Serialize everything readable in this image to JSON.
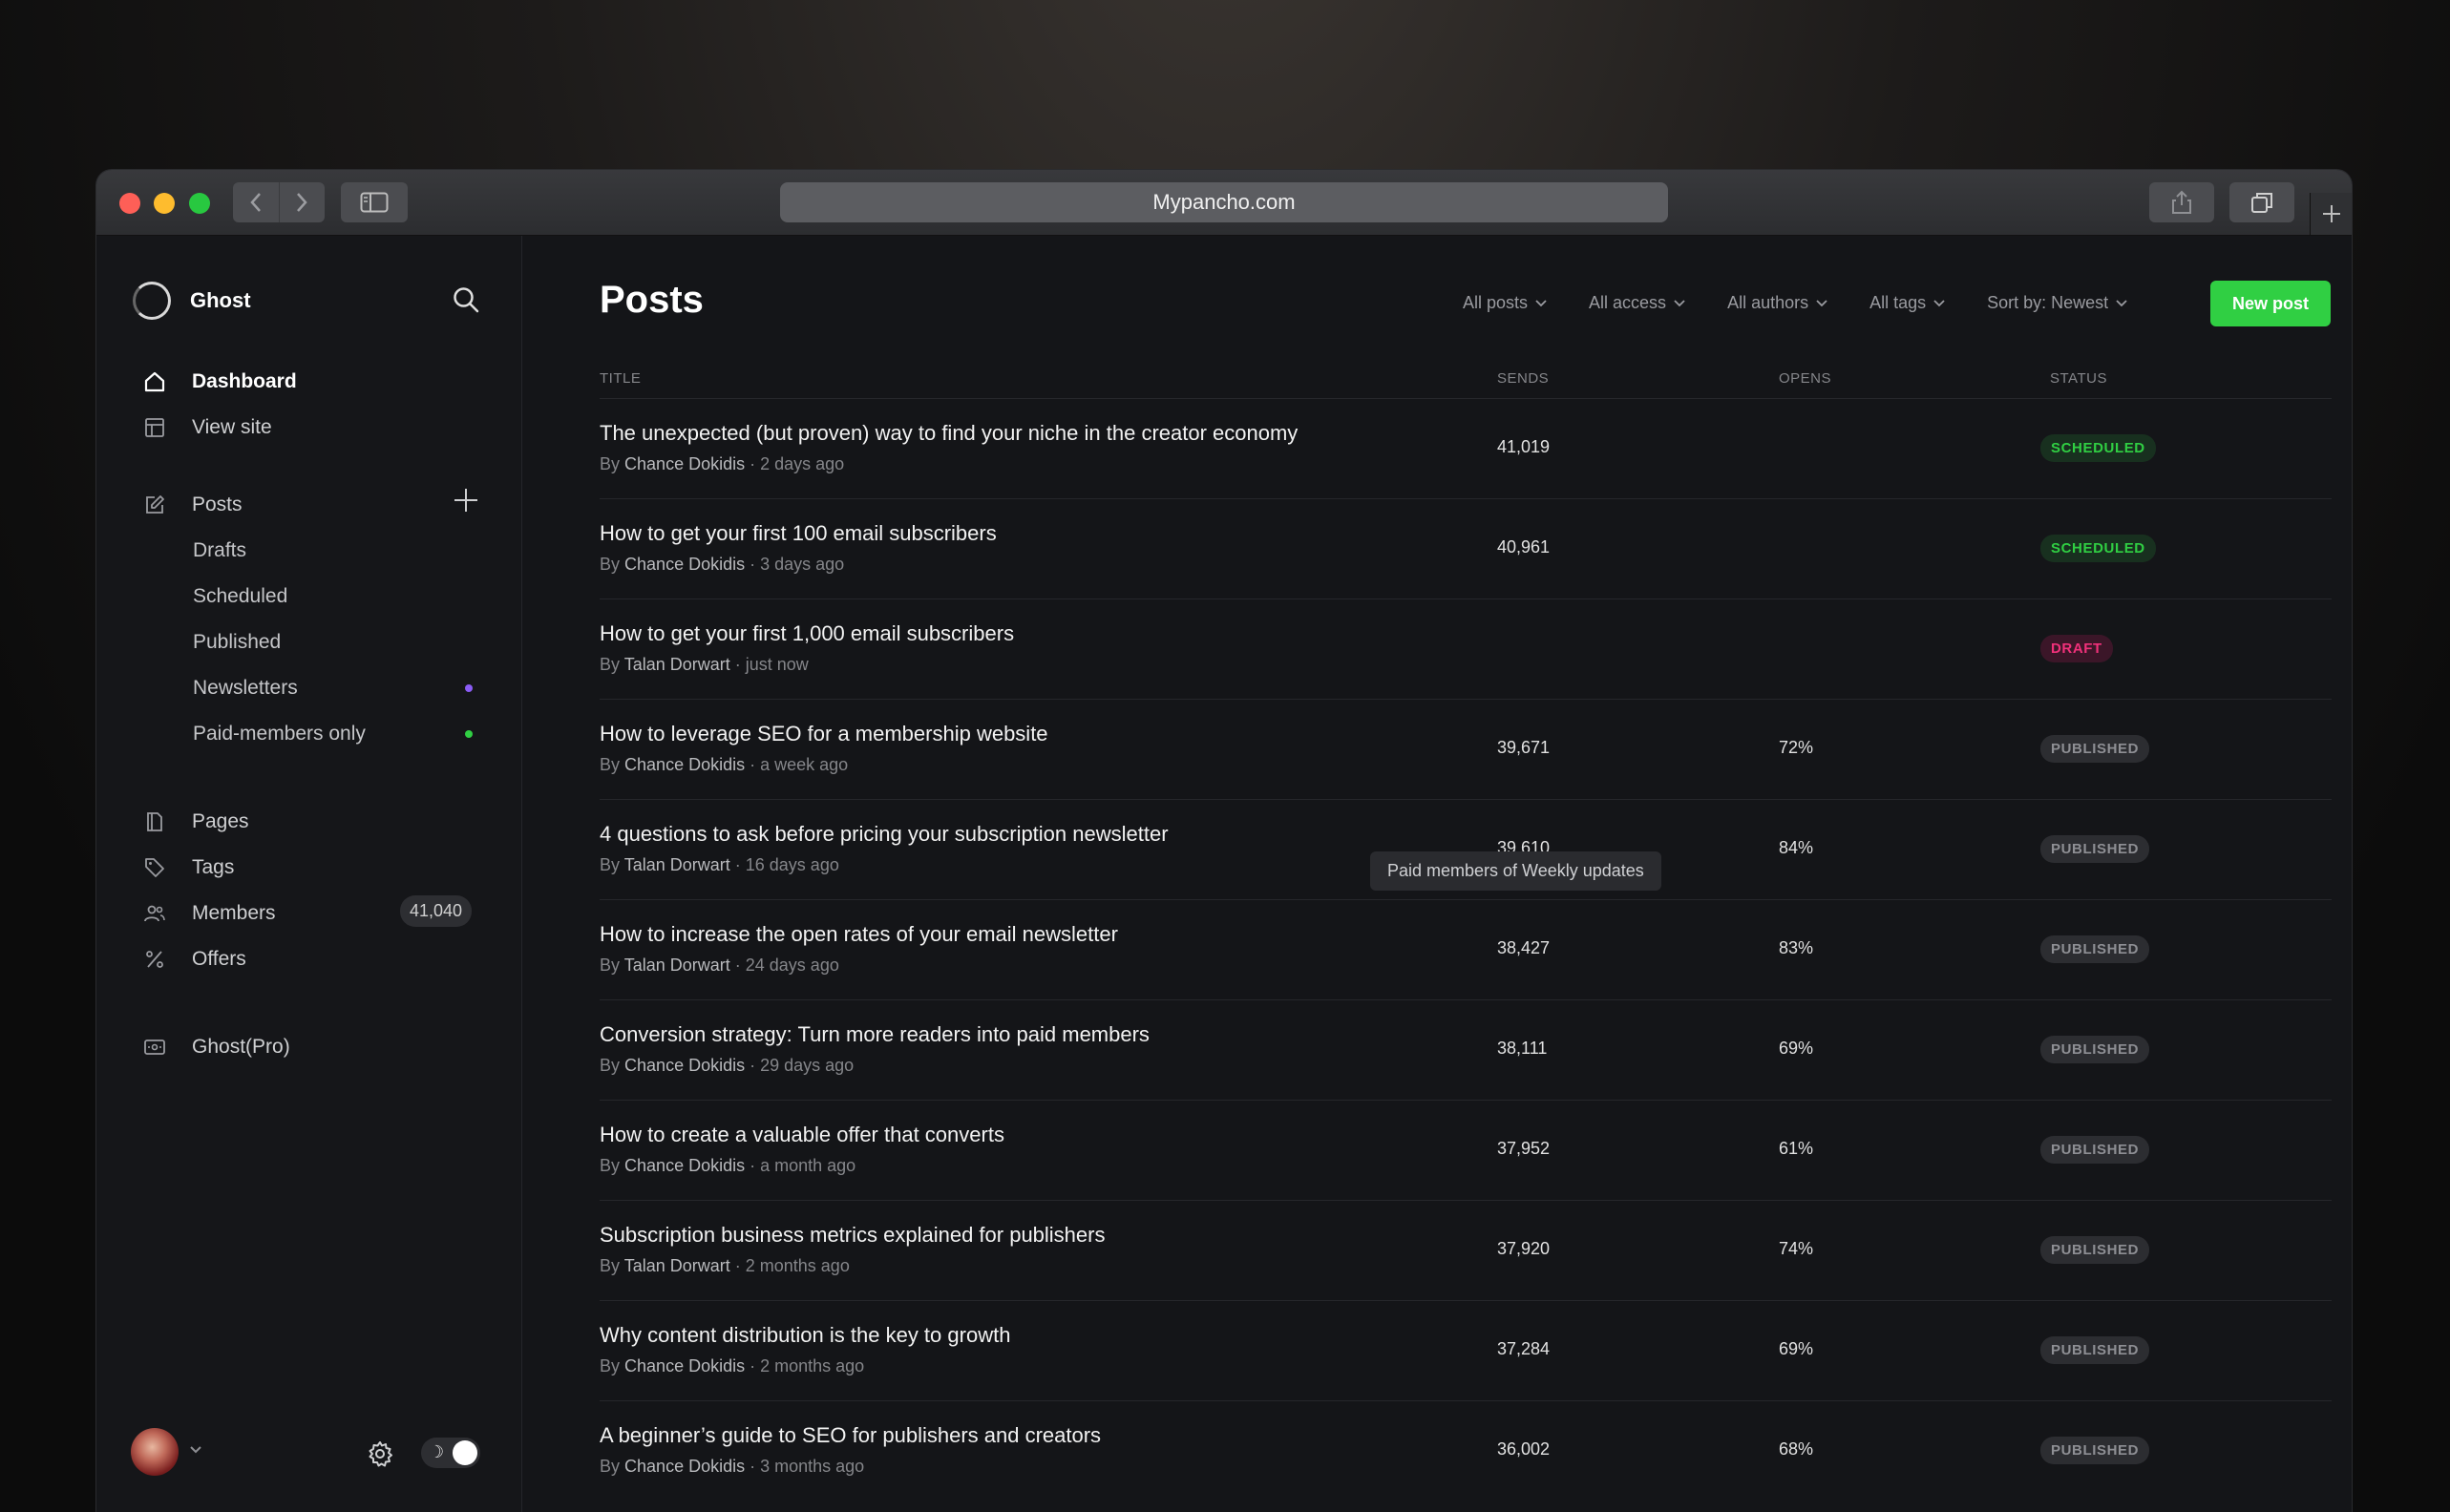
{
  "browser": {
    "url": "Mypancho.com"
  },
  "sidebar": {
    "brand": "Ghost",
    "primary": [
      {
        "label": "Dashboard",
        "icon": "home-icon"
      },
      {
        "label": "View site",
        "icon": "layout-icon"
      }
    ],
    "posts_label": "Posts",
    "sub_items": [
      {
        "label": "Drafts"
      },
      {
        "label": "Scheduled"
      },
      {
        "label": "Published"
      },
      {
        "label": "Newsletters",
        "dot_color": "#8b5cf6"
      },
      {
        "label": "Paid-members only",
        "dot_color": "#30cf43"
      }
    ],
    "secondary": [
      {
        "label": "Pages",
        "icon": "pages-icon"
      },
      {
        "label": "Tags",
        "icon": "tag-icon"
      },
      {
        "label": "Members",
        "icon": "members-icon",
        "count": "41,040"
      },
      {
        "label": "Offers",
        "icon": "percent-icon"
      }
    ],
    "pro_label": "Ghost(Pro)",
    "toggle_moon": "☽"
  },
  "main": {
    "title": "Posts",
    "filters": [
      "All posts",
      "All access",
      "All authors",
      "All tags",
      "Sort by: Newest"
    ],
    "new_post": "New post",
    "columns": {
      "title": "TITLE",
      "sends": "SENDS",
      "opens": "OPENS",
      "status": "STATUS"
    },
    "tooltip": "Paid members of Weekly updates",
    "posts": [
      {
        "title": "The unexpected (but proven) way to find your niche in the creator economy",
        "by": "By",
        "author": "Chance Dokidis",
        "time": "· 2 days ago",
        "sends": "41,019",
        "opens": "",
        "status": "SCHEDULED",
        "status_kind": "scheduled"
      },
      {
        "title": "How to get your first 100 email subscribers",
        "by": "By",
        "author": "Chance Dokidis",
        "time": "· 3 days ago",
        "sends": "40,961",
        "opens": "",
        "status": "SCHEDULED",
        "status_kind": "scheduled"
      },
      {
        "title": "How to get your first 1,000 email subscribers",
        "by": "By",
        "author": "Talan Dorwart",
        "time": "· just now",
        "sends": "",
        "opens": "",
        "status": "DRAFT",
        "status_kind": "draft"
      },
      {
        "title": "How to leverage SEO for a membership website",
        "by": "By",
        "author": "Chance Dokidis",
        "time": "· a week ago",
        "sends": "39,671",
        "opens": "72%",
        "status": "PUBLISHED",
        "status_kind": "published"
      },
      {
        "title": "4 questions to ask before pricing your subscription newsletter",
        "by": "By",
        "author": "Talan Dorwart",
        "time": "· 16 days ago",
        "sends": "39,610",
        "opens": "84%",
        "status": "PUBLISHED",
        "status_kind": "published"
      },
      {
        "title": "How to increase the open rates of your email newsletter",
        "by": "By",
        "author": "Talan Dorwart",
        "time": "· 24 days ago",
        "sends": "38,427",
        "opens": "83%",
        "status": "PUBLISHED",
        "status_kind": "published"
      },
      {
        "title": "Conversion strategy: Turn more readers into paid members",
        "by": "By",
        "author": "Chance Dokidis",
        "time": "· 29 days ago",
        "sends": "38,111",
        "opens": "69%",
        "status": "PUBLISHED",
        "status_kind": "published"
      },
      {
        "title": "How to create a valuable offer that converts",
        "by": "By",
        "author": "Chance Dokidis",
        "time": "· a month ago",
        "sends": "37,952",
        "opens": "61%",
        "status": "PUBLISHED",
        "status_kind": "published"
      },
      {
        "title": "Subscription business metrics explained for publishers",
        "by": "By",
        "author": "Talan Dorwart",
        "time": "· 2 months ago",
        "sends": "37,920",
        "opens": "74%",
        "status": "PUBLISHED",
        "status_kind": "published"
      },
      {
        "title": "Why content distribution is the key to growth",
        "by": "By",
        "author": "Chance Dokidis",
        "time": "· 2 months ago",
        "sends": "37,284",
        "opens": "69%",
        "status": "PUBLISHED",
        "status_kind": "published"
      },
      {
        "title": "A beginner’s guide to SEO for publishers and creators",
        "by": "By",
        "author": "Chance Dokidis",
        "time": "· 3 months ago",
        "sends": "36,002",
        "opens": "68%",
        "status": "PUBLISHED",
        "status_kind": "published"
      }
    ]
  },
  "colors": {
    "accent": "#30cf43",
    "draft": "#f0317a",
    "newsletter_dot": "#8b5cf6"
  }
}
